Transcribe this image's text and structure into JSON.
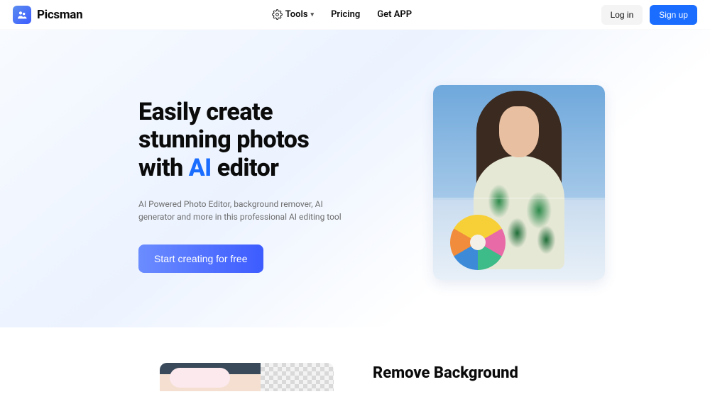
{
  "brand": {
    "name": "Picsman"
  },
  "nav": {
    "tools": "Tools",
    "pricing": "Pricing",
    "getapp": "Get APP"
  },
  "auth": {
    "login": "Log in",
    "signup": "Sign up"
  },
  "hero": {
    "title_line1": "Easily create",
    "title_line2": "stunning photos",
    "title_line3a": "with ",
    "title_ai": "AI",
    "title_line3b": " editor",
    "subtitle": "AI Powered Photo Editor, background remover, AI generator and more in this professional AI editing tool",
    "cta": "Start creating for free"
  },
  "section2": {
    "title": "Remove Background"
  }
}
